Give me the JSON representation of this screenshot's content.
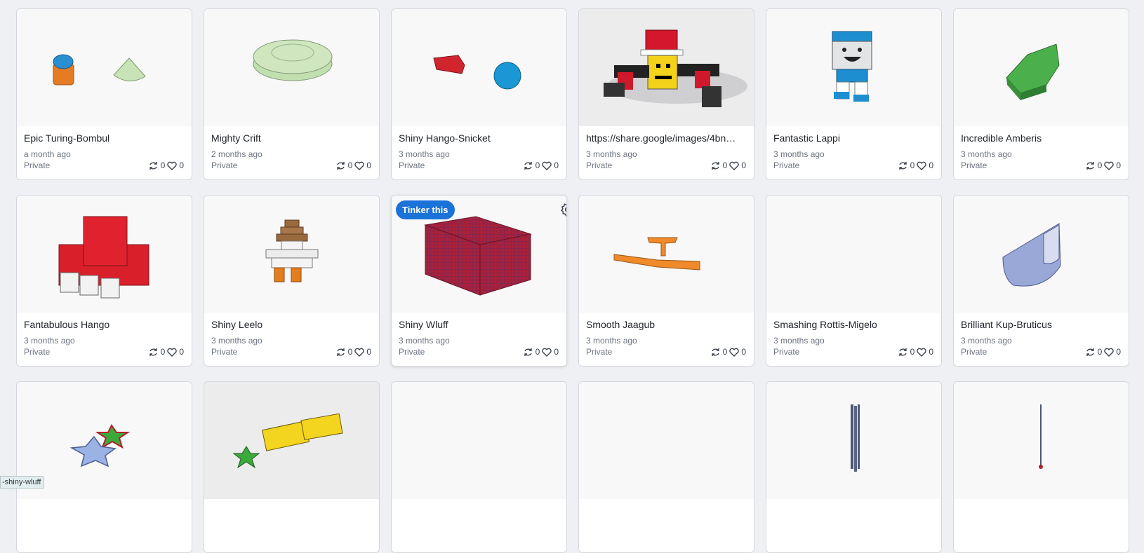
{
  "designs": [
    {
      "title": "Epic Turing-Bombul",
      "time": "a month ago",
      "visibility": "Private",
      "remixes": "0",
      "likes": "0"
    },
    {
      "title": "Mighty Crift",
      "time": "2 months ago",
      "visibility": "Private",
      "remixes": "0",
      "likes": "0"
    },
    {
      "title": "Shiny Hango-Snicket",
      "time": "3 months ago",
      "visibility": "Private",
      "remixes": "0",
      "likes": "0"
    },
    {
      "title": "https://share.google/images/4bn…",
      "time": "3 months ago",
      "visibility": "Private",
      "remixes": "0",
      "likes": "0"
    },
    {
      "title": "Fantastic Lappi",
      "time": "3 months ago",
      "visibility": "Private",
      "remixes": "0",
      "likes": "0"
    },
    {
      "title": "Incredible Amberis",
      "time": "3 months ago",
      "visibility": "Private",
      "remixes": "0",
      "likes": "0"
    },
    {
      "title": "Fantabulous Hango",
      "time": "3 months ago",
      "visibility": "Private",
      "remixes": "0",
      "likes": "0"
    },
    {
      "title": "Shiny Leelo",
      "time": "3 months ago",
      "visibility": "Private",
      "remixes": "0",
      "likes": "0"
    },
    {
      "title": "Shiny Wluff",
      "time": "3 months ago",
      "visibility": "Private",
      "remixes": "0",
      "likes": "0"
    },
    {
      "title": "Smooth Jaagub",
      "time": "3 months ago",
      "visibility": "Private",
      "remixes": "0",
      "likes": "0"
    },
    {
      "title": "Smashing Rottis-Migelo",
      "time": "3 months ago",
      "visibility": "Private",
      "remixes": "0",
      "likes": "0"
    },
    {
      "title": "Brilliant Kup-Bruticus",
      "time": "3 months ago",
      "visibility": "Private",
      "remixes": "0",
      "likes": "0"
    }
  ],
  "hover_card": {
    "tinker_label": "Tinker this"
  },
  "status_bar": {
    "url": "-shiny-wluff"
  },
  "icons": {
    "remix": "remix-icon",
    "like": "heart-icon",
    "settings": "gear-icon"
  },
  "colors": {
    "accent": "#1b72d8"
  }
}
